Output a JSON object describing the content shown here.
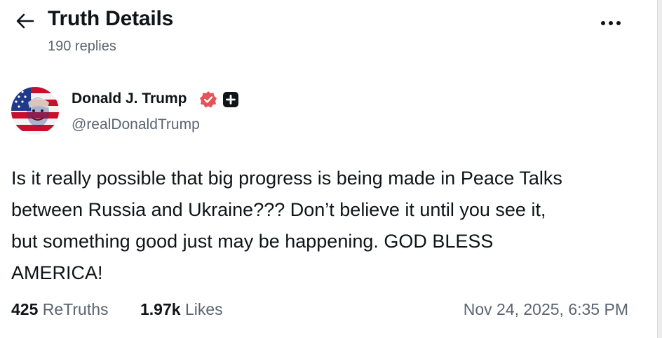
{
  "header": {
    "title": "Truth Details",
    "reply_count": "190 replies"
  },
  "author": {
    "name": "Donald J. Trump",
    "handle": "@realDonaldTrump",
    "verified_badge_color": "#e5535b"
  },
  "post": {
    "text": "Is it really possible that big progress is being made in Peace Talks\nbetween Russia and Ukraine??? Don’t believe it until you see it,\nbut something good just may be happening. GOD BLESS\nAMERICA!"
  },
  "stats": {
    "retruths_count": "425",
    "retruths_label": "ReTruths",
    "likes_count": "1.97k",
    "likes_label": "Likes",
    "timestamp": "Nov 24, 2025, 6:35 PM"
  },
  "icons": {
    "back": "arrow-left-icon",
    "more": "ellipsis-icon",
    "verified": "verified-badge-icon",
    "plus": "plus-badge-icon"
  }
}
